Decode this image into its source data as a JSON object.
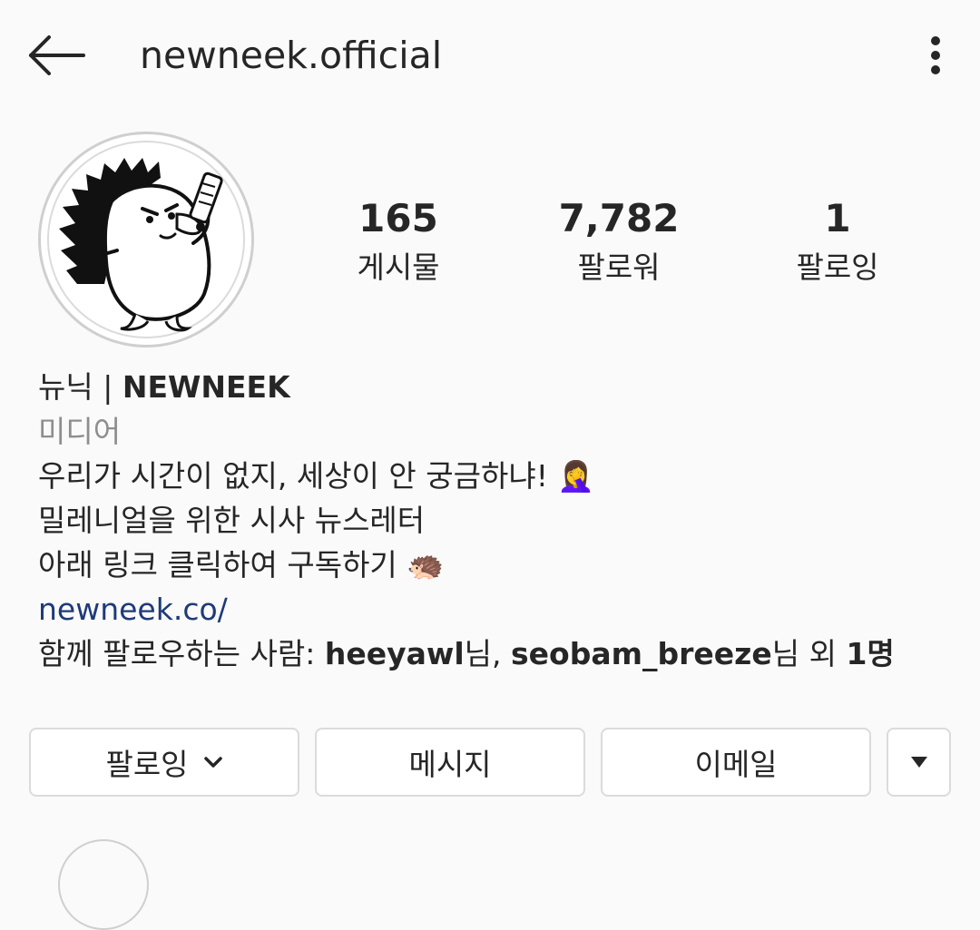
{
  "header": {
    "username": "newneek.official",
    "back_icon": "arrow-left-icon",
    "more_icon": "vertical-dots-icon"
  },
  "stats": [
    {
      "value": "165",
      "label": "게시물"
    },
    {
      "value": "7,782",
      "label": "팔로워"
    },
    {
      "value": "1",
      "label": "팔로잉"
    }
  ],
  "bio": {
    "name_prefix": "뉴닉 | ",
    "name_bold": "NEWNEEK",
    "category": "미디어",
    "line1": "우리가 시간이 없지, 세상이 안 궁금하냐! ",
    "line1_emoji": "🤦‍♀️",
    "line2": "밀레니얼을 위한 시사 뉴스레터",
    "line3": "아래 링크 클릭하여 구독하기 ",
    "line3_emoji": "🦔",
    "link": "newneek.co/",
    "followed_by_prefix": "함께 팔로우하는 사람: ",
    "follower1": "heeyawl",
    "suffix1": "님, ",
    "follower2": "seobam_breeze",
    "suffix2": "님 외 ",
    "others_count": "1명"
  },
  "actions": {
    "following_label": "팔로잉",
    "message_label": "메시지",
    "email_label": "이메일"
  },
  "colors": {
    "background": "#fafafa",
    "text": "#262626",
    "secondary_text": "#8e8e8e",
    "link": "#1e3a78",
    "border": "#dbdbdb"
  }
}
